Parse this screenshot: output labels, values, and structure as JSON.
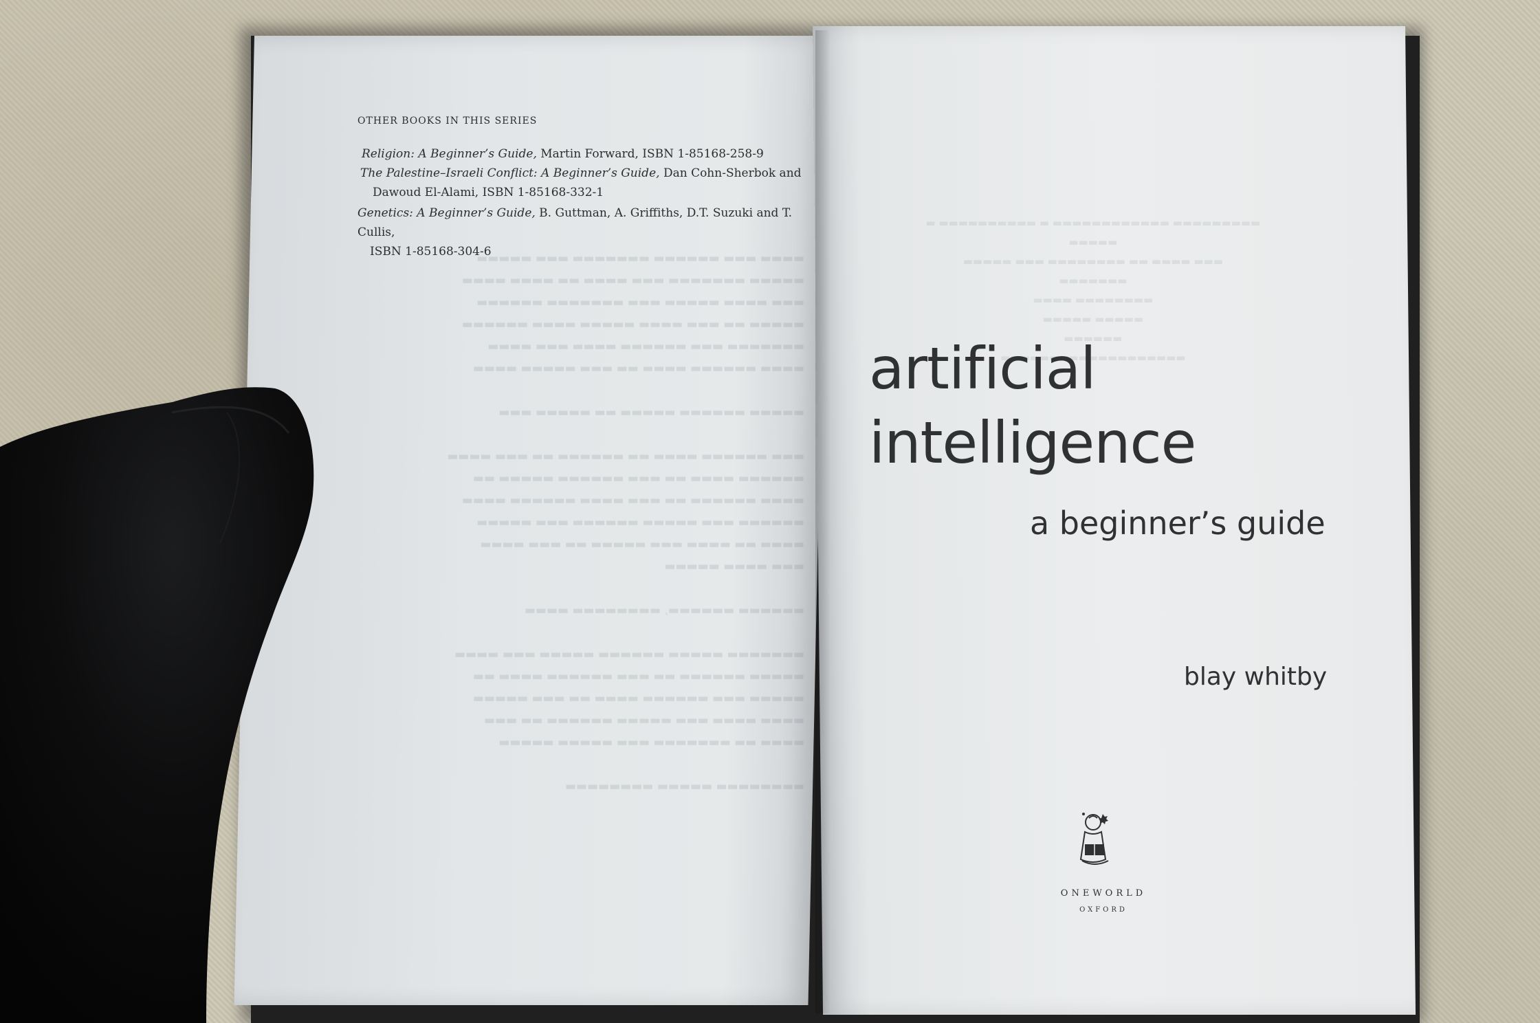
{
  "left_page": {
    "heading": "OTHER BOOKS IN THIS SERIES",
    "books": [
      {
        "title": "Religion: A Beginner’s Guide,",
        "detail": " Martin Forward, ISBN 1-85168-258-9",
        "continuation": ""
      },
      {
        "title": "The Palestine–Israeli Conflict: A Beginner’s Guide,",
        "detail": " Dan Cohn-Sherbok and",
        "continuation": "Dawoud El-Alami, ISBN 1-85168-332-1"
      },
      {
        "title": "Genetics: A Beginner’s Guide,",
        "detail": " B. Guttman, A. Griffiths, D.T. Suzuki and T. Cullis,",
        "continuation": "ISBN 1-85168-304-6"
      }
    ]
  },
  "right_page": {
    "title_line1": "artificial",
    "title_line2": "intelligence",
    "subtitle": "a beginner’s guide",
    "author": "blay whitby",
    "publisher": "ONEWORLD",
    "place": "OXFORD"
  },
  "colors": {
    "ink": "#2f3133",
    "page": "#e8eaeb",
    "sock": "#0c0c0d",
    "carpet": "#c9c4b1"
  },
  "icons": {
    "publisher_logo": "reading-figure-icon"
  }
}
